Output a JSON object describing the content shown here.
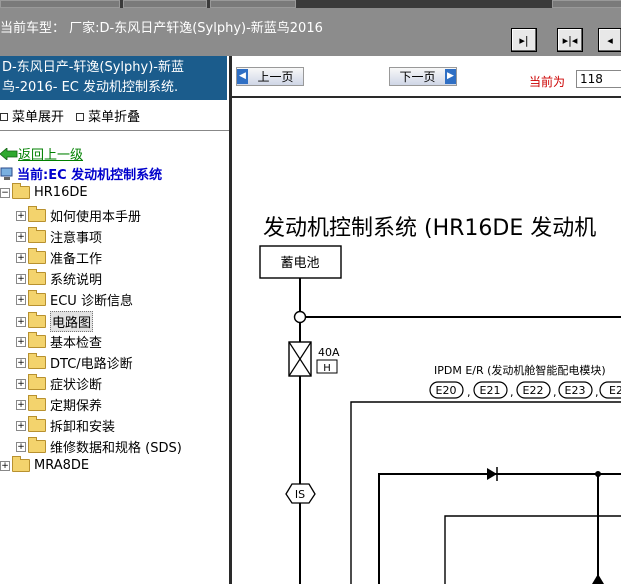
{
  "header": {
    "vehicle_label": "当前车型：  厂家:D-东风日产轩逸(Sylphy)-新蓝鸟2016"
  },
  "nav_buttons": [
    {
      "name": "nav-first-button",
      "glyph": "▸|"
    },
    {
      "name": "nav-middle-button",
      "glyph": "▸|◂"
    },
    {
      "name": "nav-last-button",
      "glyph": "◂"
    }
  ],
  "sidebar": {
    "title_line1": "D-东风日产-轩逸(Sylphy)-新蓝",
    "title_line2": "鸟-2016- EC 发动机控制系统.",
    "expand_label": "菜单展开",
    "collapse_label": "菜单折叠",
    "back_label": "返回上一级",
    "current_label": "当前:EC 发动机控制系统",
    "root_label": "HR16DE",
    "items": [
      {
        "label": "如何使用本手册"
      },
      {
        "label": "注意事项"
      },
      {
        "label": "准备工作"
      },
      {
        "label": "系统说明"
      },
      {
        "label": "ECU 诊断信息"
      },
      {
        "label": "电路图",
        "selected": true
      },
      {
        "label": "基本检查"
      },
      {
        "label": "DTC/电路诊断"
      },
      {
        "label": "症状诊断"
      },
      {
        "label": "定期保养"
      },
      {
        "label": "拆卸和安装"
      },
      {
        "label": "维修数据和规格 (SDS)"
      }
    ],
    "sibling_label": "MRA8DE"
  },
  "pager": {
    "prev_label": "上一页",
    "next_label": "下一页",
    "current_label": "当前为",
    "current_value": "118"
  },
  "document": {
    "title": "发动机控制系统 (HR16DE 发动机",
    "battery_label": "蓄电池",
    "fuse_amp": "40A",
    "fuse_letter": "H",
    "ipdm_label": "IPDM E/R (发动机舱智能配电模块)",
    "connectors": [
      "E20",
      "E21",
      "E22",
      "E23",
      "E2"
    ],
    "is_label": "IS"
  }
}
